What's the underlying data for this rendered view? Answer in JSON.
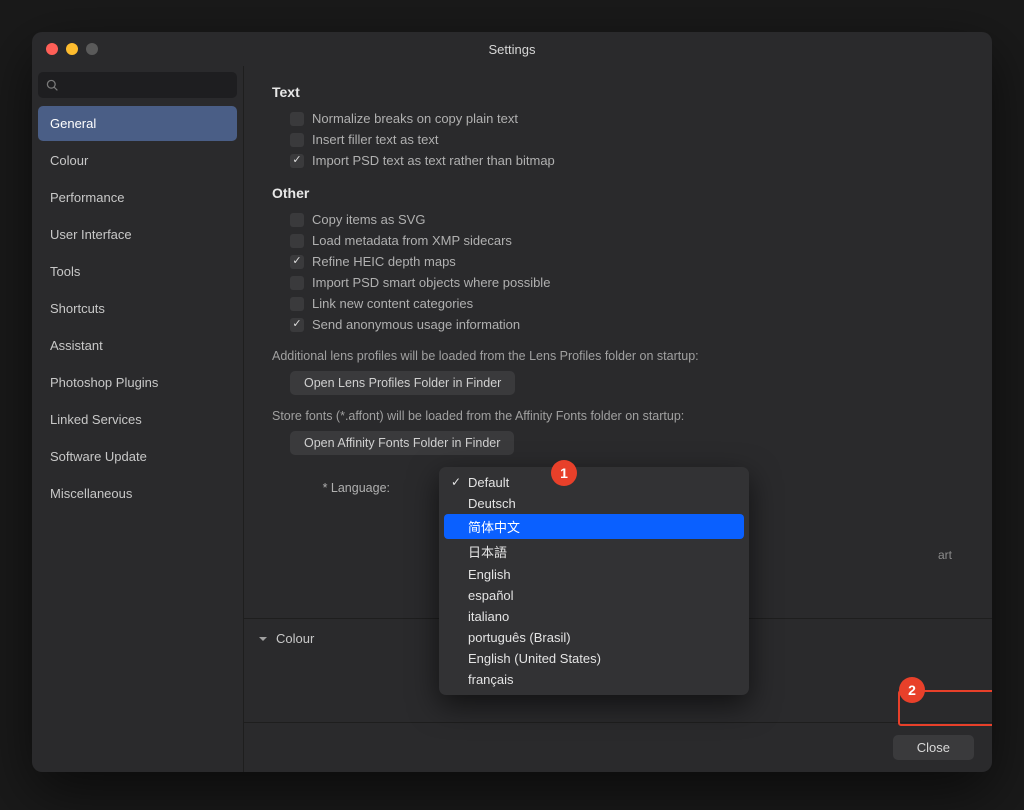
{
  "window": {
    "title": "Settings"
  },
  "sidebar": {
    "search_placeholder": "",
    "items": [
      {
        "label": "General",
        "active": true
      },
      {
        "label": "Colour"
      },
      {
        "label": "Performance"
      },
      {
        "label": "User Interface"
      },
      {
        "label": "Tools"
      },
      {
        "label": "Shortcuts"
      },
      {
        "label": "Assistant"
      },
      {
        "label": "Photoshop Plugins"
      },
      {
        "label": "Linked Services"
      },
      {
        "label": "Software Update"
      },
      {
        "label": "Miscellaneous"
      }
    ]
  },
  "sections": {
    "text": {
      "heading": "Text",
      "opts": [
        {
          "label": "Normalize breaks on copy plain text",
          "checked": false
        },
        {
          "label": "Insert filler text as text",
          "checked": false
        },
        {
          "label": "Import PSD text as text rather than bitmap",
          "checked": true
        }
      ]
    },
    "other": {
      "heading": "Other",
      "opts": [
        {
          "label": "Copy items as SVG",
          "checked": false
        },
        {
          "label": "Load metadata from XMP sidecars",
          "checked": false
        },
        {
          "label": "Refine HEIC depth maps",
          "checked": true
        },
        {
          "label": "Import PSD smart objects where possible",
          "checked": false
        },
        {
          "label": "Link new content categories",
          "checked": false
        },
        {
          "label": "Send anonymous usage information",
          "checked": true
        }
      ],
      "lens_desc": "Additional lens profiles will be loaded from the Lens Profiles folder on startup:",
      "lens_btn": "Open Lens Profiles Folder in Finder",
      "fonts_desc": "Store fonts (*.affont) will be loaded from the Affinity Fonts folder on startup:",
      "fonts_btn": "Open Affinity Fonts Folder in Finder",
      "language_label": "* Language:",
      "restart_hint": "art"
    },
    "colour_heading": "Colour"
  },
  "dropdown": {
    "items": [
      {
        "label": "Default",
        "selected": true
      },
      {
        "label": "Deutsch"
      },
      {
        "label": "简体中文",
        "highlighted": true
      },
      {
        "label": "日本語"
      },
      {
        "label": "English"
      },
      {
        "label": "español"
      },
      {
        "label": "italiano"
      },
      {
        "label": "português (Brasil)"
      },
      {
        "label": "English (United States)"
      },
      {
        "label": "français"
      }
    ]
  },
  "footer": {
    "close": "Close"
  },
  "callouts": {
    "c1": "1",
    "c2": "2"
  }
}
